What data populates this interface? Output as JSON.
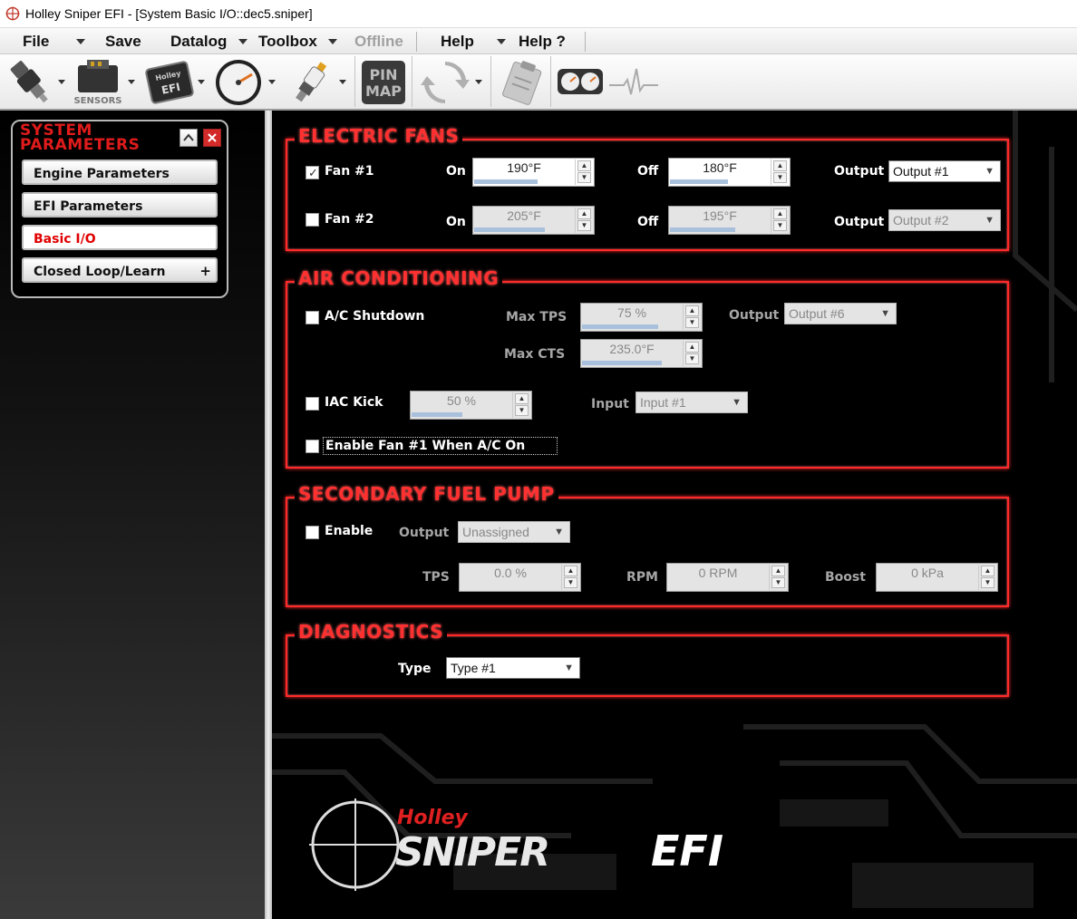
{
  "window": {
    "title": "Holley Sniper EFI - [System Basic I/O::dec5.sniper]"
  },
  "menu": {
    "file": "File",
    "save": "Save",
    "datalog": "Datalog",
    "toolbox": "Toolbox",
    "offline": "Offline",
    "help": "Help",
    "help_q": "Help ?"
  },
  "toolbar": {
    "sensors_label": "SENSORS",
    "efi_label": "EFI",
    "pinmap_top": "PIN",
    "pinmap_bottom": "MAP",
    "holley_label": "Holley"
  },
  "sidebar": {
    "title_line1": "SYSTEM",
    "title_line2": "PARAMETERS",
    "items": [
      {
        "label": "Engine Parameters",
        "active": false
      },
      {
        "label": "EFI Parameters",
        "active": false
      },
      {
        "label": "Basic I/O",
        "active": true
      },
      {
        "label": "Closed Loop/Learn",
        "active": false,
        "expander": "+"
      }
    ]
  },
  "electric_fans": {
    "title": "ELECTRIC FANS",
    "fan1": {
      "label": "Fan #1",
      "checked": true,
      "on_label": "On",
      "on_value": "190°F",
      "off_label": "Off",
      "off_value": "180°F",
      "output_label": "Output",
      "output_value": "Output #1"
    },
    "fan2": {
      "label": "Fan #2",
      "checked": false,
      "on_label": "On",
      "on_value": "205°F",
      "off_label": "Off",
      "off_value": "195°F",
      "output_label": "Output",
      "output_value": "Output #2"
    }
  },
  "air_conditioning": {
    "title": "AIR CONDITIONING",
    "shutdown_label": "A/C Shutdown",
    "max_tps_label": "Max TPS",
    "max_tps_value": "75 %",
    "output_label": "Output",
    "output_value": "Output #6",
    "max_cts_label": "Max CTS",
    "max_cts_value": "235.0°F",
    "iac_kick_label": "IAC Kick",
    "iac_kick_value": "50 %",
    "input_label": "Input",
    "input_value": "Input #1",
    "enable_fan_label": "Enable Fan #1 When A/C On"
  },
  "secondary_fuel_pump": {
    "title": "SECONDARY FUEL PUMP",
    "enable_label": "Enable",
    "output_label": "Output",
    "output_value": "Unassigned",
    "tps_label": "TPS",
    "tps_value": "0.0 %",
    "rpm_label": "RPM",
    "rpm_value": "0 RPM",
    "boost_label": "Boost",
    "boost_value": "0 kPa"
  },
  "diagnostics": {
    "title": "DIAGNOSTICS",
    "type_label": "Type",
    "type_value": "Type #1"
  },
  "brand": {
    "holley": "Holley",
    "sniper": "SNIPER",
    "efi": "EFI"
  },
  "colors": {
    "accent_red": "#ff2a2a",
    "active_nav": "#e00000"
  }
}
